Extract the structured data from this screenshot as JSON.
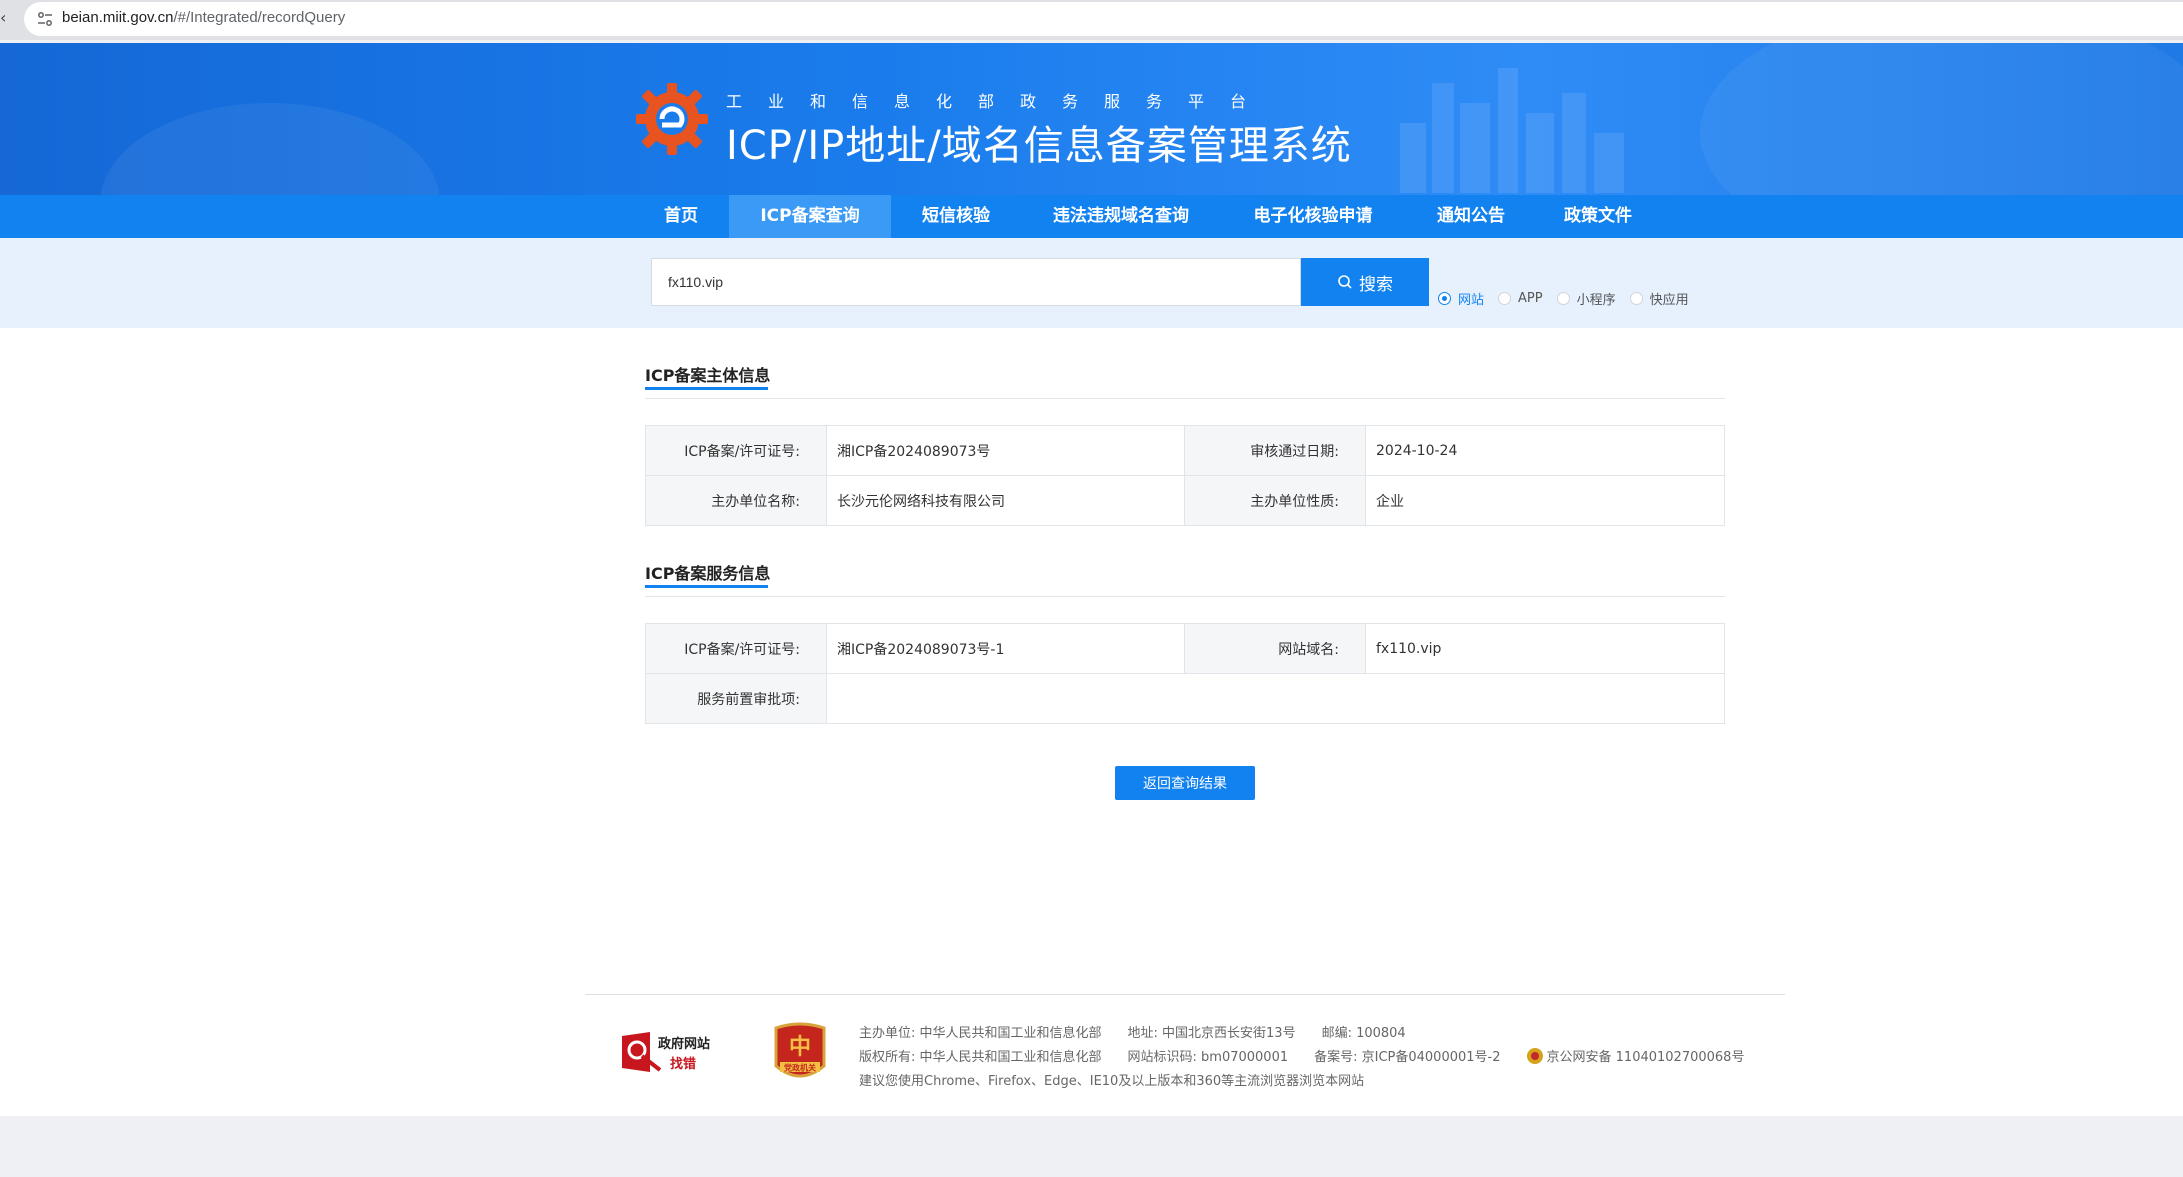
{
  "browser": {
    "url_host": "beian.miit.gov.cn",
    "url_path": "/#/Integrated/recordQuery"
  },
  "header": {
    "subtitle": "工业和信息化部政务服务平台",
    "title": "ICP/IP地址/域名信息备案管理系统"
  },
  "nav": {
    "items": [
      {
        "label": "首页"
      },
      {
        "label": "ICP备案查询"
      },
      {
        "label": "短信核验"
      },
      {
        "label": "违法违规域名查询"
      },
      {
        "label": "电子化核验申请"
      },
      {
        "label": "通知公告"
      },
      {
        "label": "政策文件"
      }
    ],
    "active_index": 1
  },
  "search": {
    "value": "fx110.vip",
    "button_label": "搜索",
    "types": [
      {
        "label": "网站",
        "checked": true
      },
      {
        "label": "APP",
        "checked": false
      },
      {
        "label": "小程序",
        "checked": false
      },
      {
        "label": "快应用",
        "checked": false
      }
    ]
  },
  "entity": {
    "title": "ICP备案主体信息",
    "license_label": "ICP备案/许可证号:",
    "license_value": "湘ICP备2024089073号",
    "date_label": "审核通过日期:",
    "date_value": "2024-10-24",
    "org_label": "主办单位名称:",
    "org_value": "长沙元伦网络科技有限公司",
    "nature_label": "主办单位性质:",
    "nature_value": "企业"
  },
  "service": {
    "title": "ICP备案服务信息",
    "license_label": "ICP备案/许可证号:",
    "license_value": "湘ICP备2024089073号-1",
    "domain_label": "网站域名:",
    "domain_value": "fx110.vip",
    "approval_label": "服务前置审批项:",
    "approval_value": ""
  },
  "actions": {
    "back_label": "返回查询结果"
  },
  "footer": {
    "gov_badge_line1": "政府网站",
    "gov_badge_line2": "找错",
    "party_badge_text": "党政机关",
    "line1": "主办单位: 中华人民共和国工业和信息化部　　地址: 中国北京西长安街13号　　邮编: 100804",
    "line2_a": "版权所有: 中华人民共和国工业和信息化部　　网站标识码: bm07000001　　备案号: 京ICP备04000001号-2　　",
    "line2_b": "京公网安备 11040102700068号",
    "line3": "建议您使用Chrome、Firefox、Edge、IE10及以上版本和360等主流浏览器浏览本网站"
  },
  "colors": {
    "primary": "#1282f0",
    "banner": "#1a7cec",
    "search_strip": "#e6f1fd"
  }
}
